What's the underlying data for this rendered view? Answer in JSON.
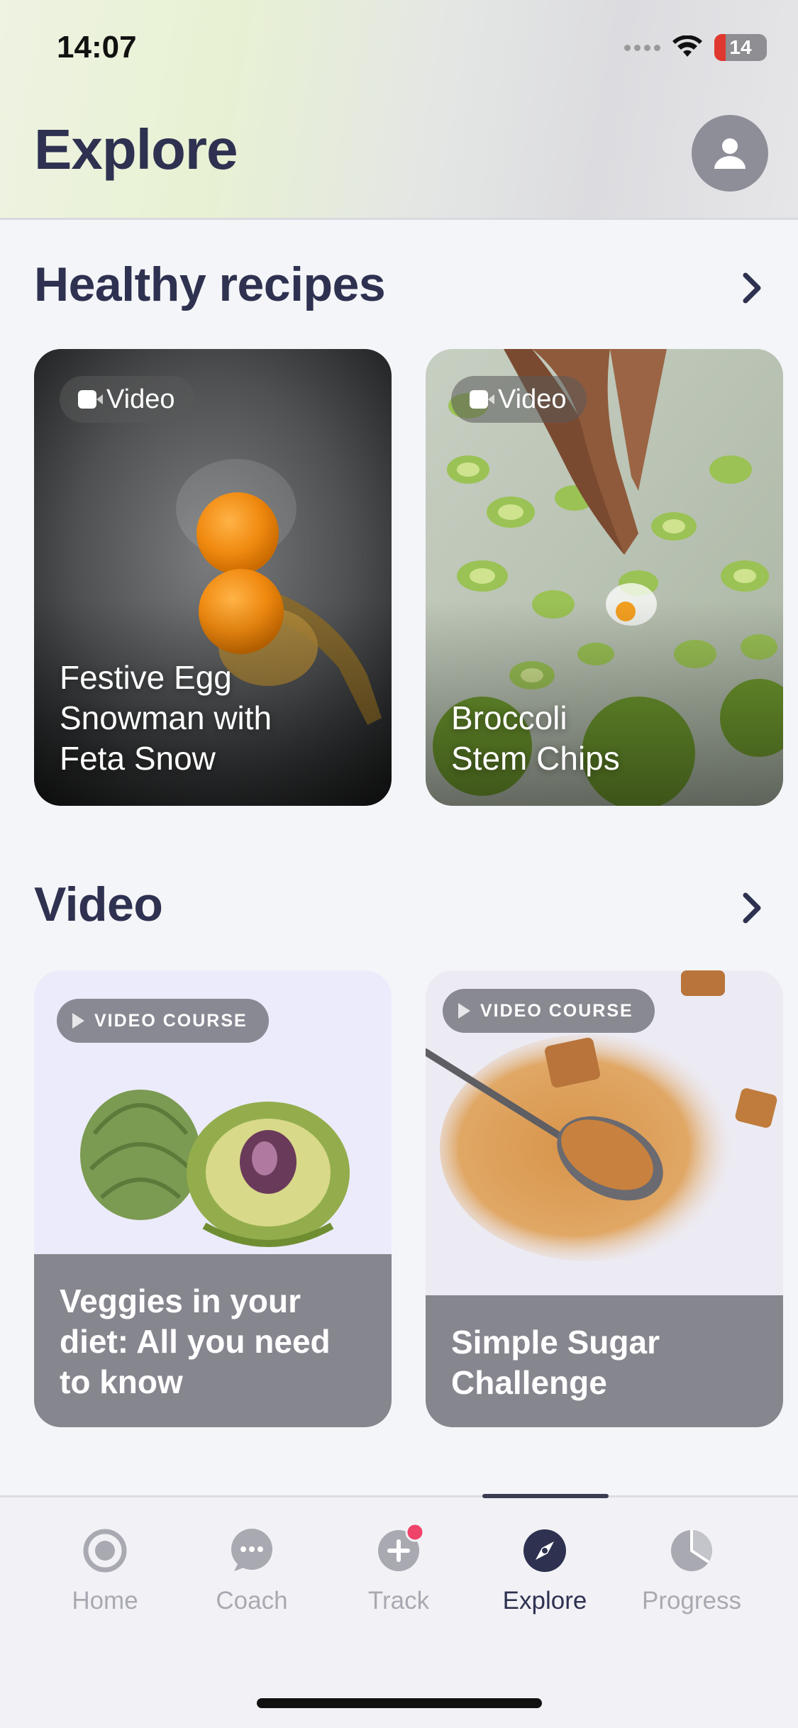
{
  "status_bar": {
    "time": "14:07",
    "battery": "14"
  },
  "header": {
    "title": "Explore"
  },
  "sections": {
    "recipes": {
      "title": "Healthy recipes",
      "cards": [
        {
          "badge": "Video",
          "title_lines": [
            "Festive Egg",
            "Snowman with",
            "Feta Snow"
          ]
        },
        {
          "badge": "Video",
          "title_lines": [
            "Broccoli",
            "Stem Chips"
          ]
        }
      ]
    },
    "video": {
      "title": "Video",
      "cards": [
        {
          "badge": "VIDEO COURSE",
          "title_lines": [
            "Veggies in your",
            "diet: All you need",
            "to know"
          ]
        },
        {
          "badge": "VIDEO COURSE",
          "title_lines": [
            "Simple Sugar",
            "Challenge"
          ]
        }
      ]
    }
  },
  "tabbar": {
    "tabs": [
      {
        "label": "Home",
        "icon": "home-icon"
      },
      {
        "label": "Coach",
        "icon": "chat-icon"
      },
      {
        "label": "Track",
        "icon": "plus-icon"
      },
      {
        "label": "Explore",
        "icon": "compass-icon"
      },
      {
        "label": "Progress",
        "icon": "pie-chart-icon"
      }
    ],
    "active": "Explore"
  },
  "colors": {
    "title": "#2e3150",
    "tab_inactive": "#a9a9b2",
    "notification_dot": "#f0436a"
  }
}
